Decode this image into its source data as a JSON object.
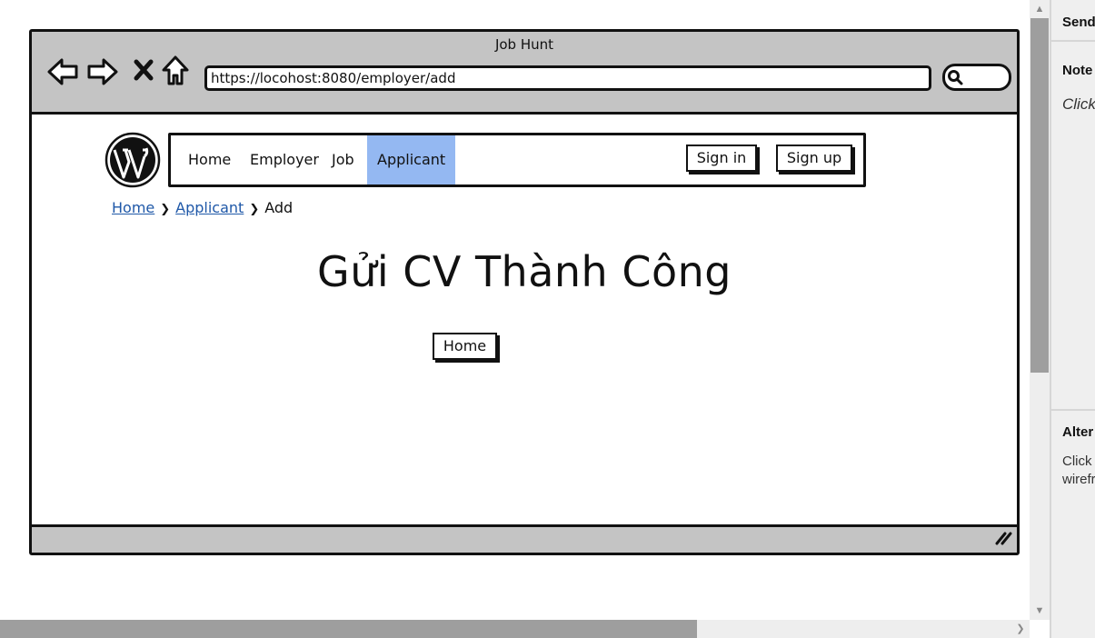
{
  "window": {
    "title": "Job Hunt",
    "url": "https://locohost:8080/employer/add"
  },
  "icons": {
    "back": "back-arrow-icon",
    "forward": "forward-arrow-icon",
    "stop": "close-icon",
    "home": "home-icon",
    "search": "search-icon",
    "logo": "wordpress-logo-icon",
    "resize": "resize-grip-icon"
  },
  "navbar": {
    "items": [
      {
        "label": "Home"
      },
      {
        "label": "Employer"
      },
      {
        "label": "Job"
      },
      {
        "label": "Applicant"
      }
    ],
    "active": "Applicant",
    "sign_in": "Sign in",
    "sign_up": "Sign up",
    "active_color": "#94b8f2"
  },
  "breadcrumb": {
    "items": [
      "Home",
      "Applicant",
      "Add"
    ],
    "link_color": "#1f58a8"
  },
  "main": {
    "heading": "Gửi CV Thành Công",
    "home_button": "Home"
  },
  "right_panel": {
    "top_title": "Send",
    "notes_title": "Note",
    "notes_text": "Click",
    "alt_title": "Alter",
    "alt_line1": "Click '",
    "alt_line2": "wirefr"
  }
}
